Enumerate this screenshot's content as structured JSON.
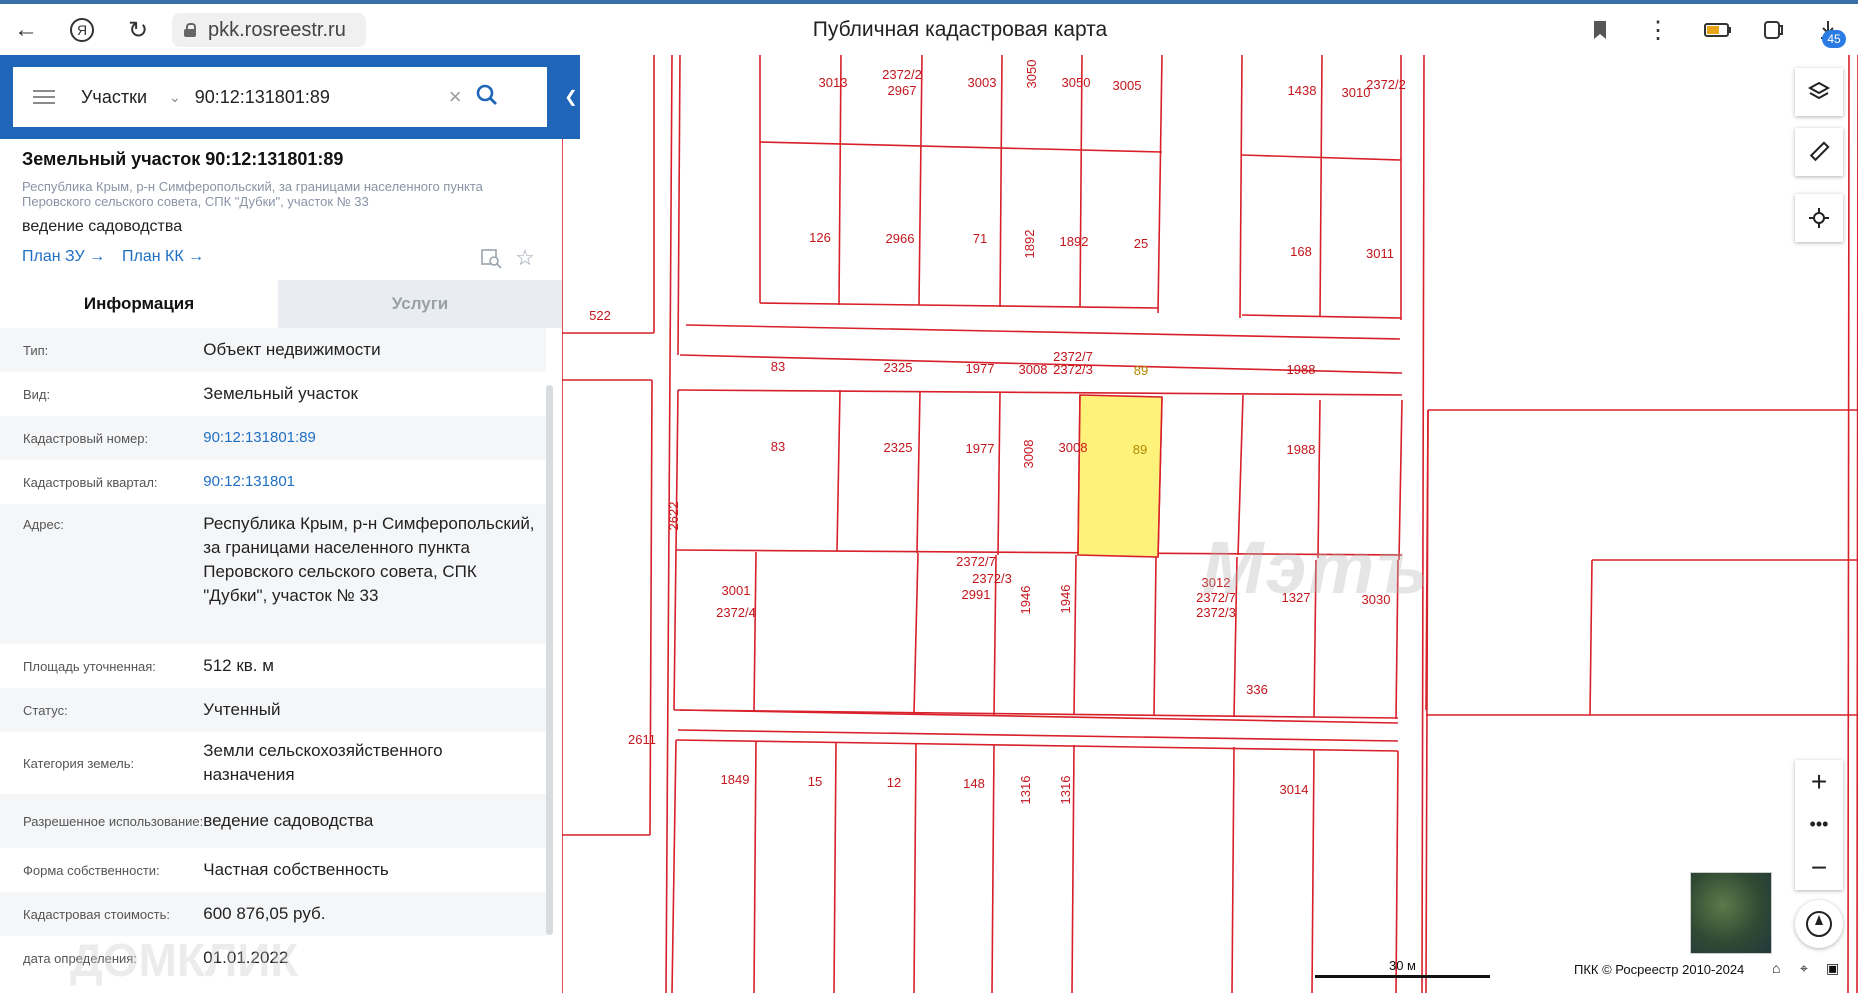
{
  "browser": {
    "url": "pkk.rosreestr.ru",
    "title": "Публичная кадастровая карта",
    "badge": "45"
  },
  "search": {
    "selector": "Участки",
    "value": "90:12:131801:89"
  },
  "object": {
    "title": "Земельный участок 90:12:131801:89",
    "address": "Республика Крым, р-н Симферопольский, за границами населенного пункта Перовского сельского совета, СПК \"Дубки\", участок № 33",
    "use": "ведение садоводства",
    "links": [
      "План ЗУ →",
      "План КК →"
    ]
  },
  "tabs": {
    "info": "Информация",
    "services": "Услуги"
  },
  "info_rows": [
    {
      "label": "Тип:",
      "value": "Объект недвижимости"
    },
    {
      "label": "Вид:",
      "value": "Земельный участок"
    },
    {
      "label": "Кадастровый номер:",
      "value": "90:12:131801:89"
    },
    {
      "label": "Кадастровый квартал:",
      "value": "90:12:131801"
    },
    {
      "label": "Адрес:",
      "value": "Республика Крым, р-н Симферопольский, за границами населенного пункта Перовского сельского совета, СПК \"Дубки\", участок № 33"
    },
    {
      "label": "Площадь уточненная:",
      "value": "512 кв. м"
    },
    {
      "label": "Статус:",
      "value": "Учтенный"
    },
    {
      "label": "Категория земель:",
      "value": "Земли сельскохозяйственного назначения"
    },
    {
      "label": "Разрешенное использование:",
      "value": "ведение садоводства"
    },
    {
      "label": "Форма собственности:",
      "value": "Частная собственность"
    },
    {
      "label": "Кадастровая стоимость:",
      "value": "600 876,05 руб."
    },
    {
      "label": "дата определения:",
      "value": "01.01.2022"
    }
  ],
  "map": {
    "parcel_labels": [
      "3013",
      "2372/2",
      "2967",
      "3003",
      "3050",
      "3050",
      "3005",
      "1438",
      "3010",
      "2372/2",
      "126",
      "2966",
      "71",
      "1892",
      "1892",
      "25",
      "168",
      "3011",
      "522",
      "83",
      "2325",
      "1977",
      "3008",
      "2372/7",
      "2372/3",
      "89",
      "1988",
      "83",
      "2325",
      "1977",
      "3008",
      "3008",
      "89",
      "1988",
      "2622",
      "2372/7",
      "2372/3",
      "2991",
      "1946",
      "1946",
      "3012",
      "2372/7",
      "2372/3",
      "3001",
      "2372/4",
      "1327",
      "3030",
      "336",
      "2611",
      "1849",
      "15",
      "12",
      "148",
      "1316",
      "1316",
      "3014",
      "25"
    ],
    "scale_label": "30 м",
    "copyright": "ПКК © Росреестр 2010-2024",
    "watermark": "Мэтъ",
    "watermark2": "ДОМКЛИК",
    "selected_color": "#fff27a",
    "line_color": "#d8202a"
  }
}
